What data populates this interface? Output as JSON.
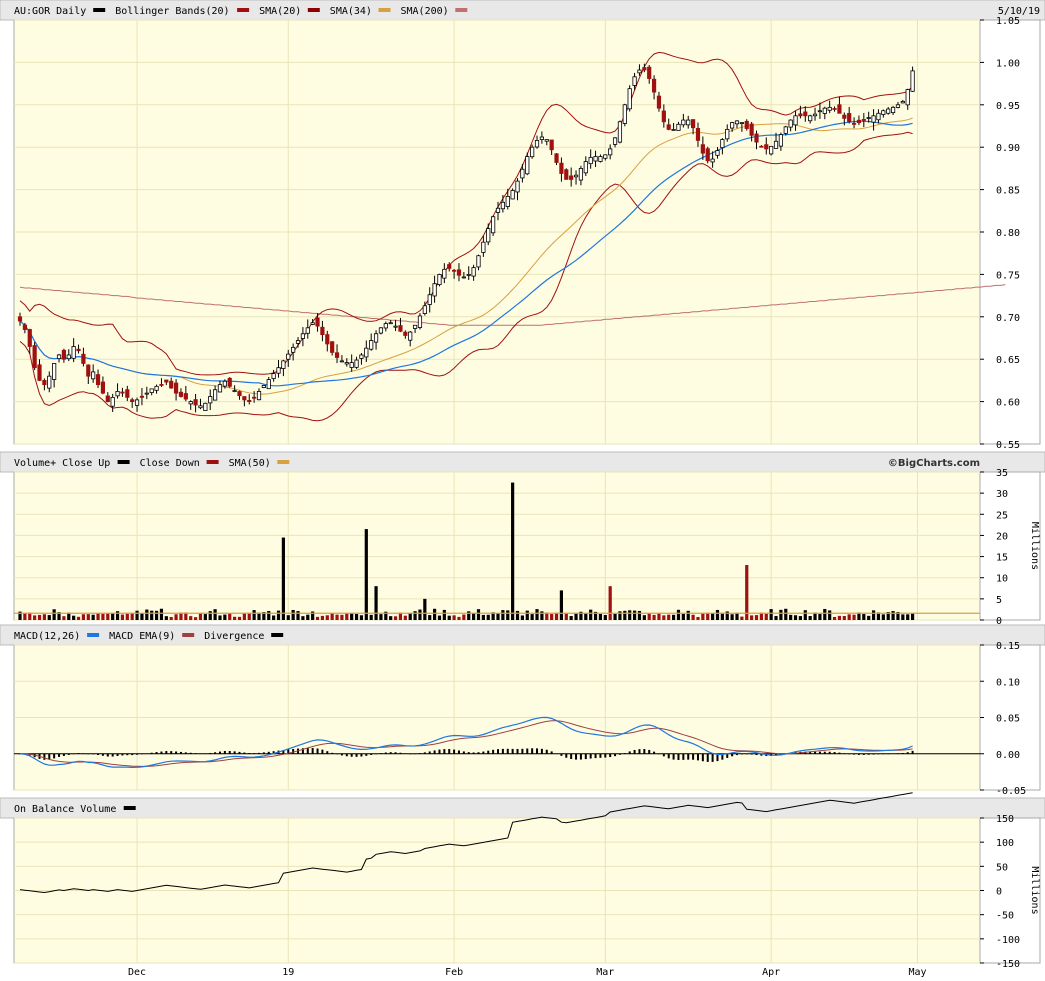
{
  "header": {
    "symbol_label": "AU:GOR Daily",
    "date": "5/10/19"
  },
  "colors": {
    "panel_bg": "#fffde1",
    "grid": "#e9e4b8",
    "header_bg": "#e8e8e8",
    "up": "#000000",
    "down": "#a01010",
    "bollinger": "#a01010",
    "sma20": "#8b0000",
    "sma34": "#d8a040",
    "sma200": "#1f77e0",
    "sma200_long": "#c07070",
    "vol_sma": "#d8a040",
    "macd": "#1f77e0",
    "macd_ema": "#a04040",
    "divergence": "#000000",
    "obv": "#000000"
  },
  "x_axis": {
    "labels": [
      {
        "text": "Dec",
        "index": 24
      },
      {
        "text": "19",
        "index": 55
      },
      {
        "text": "Feb",
        "index": 89
      },
      {
        "text": "Mar",
        "index": 120
      },
      {
        "text": "Apr",
        "index": 154
      },
      {
        "text": "May",
        "index": 184
      }
    ],
    "count": 197
  },
  "panels": [
    {
      "id": "price",
      "legend": [
        {
          "text": "AU:GOR Daily",
          "swatch": "#000000"
        },
        {
          "text": "Bollinger Bands(20)",
          "swatch": "#a01010"
        },
        {
          "text": "SMA(20)",
          "swatch": "#8b0000"
        },
        {
          "text": "SMA(34)",
          "swatch": "#d8a040"
        },
        {
          "text": "SMA(200)",
          "swatch": "#c07070"
        }
      ],
      "ticks": [
        "1.05",
        "1.00",
        "0.95",
        "0.90",
        "0.85",
        "0.80",
        "0.75",
        "0.70",
        "0.65",
        "0.60",
        "0.55"
      ],
      "ylim": [
        0.55,
        1.05
      ]
    },
    {
      "id": "volume",
      "legend": [
        {
          "text": "Volume+ Close Up",
          "swatch": "#000000"
        },
        {
          "text": "Close Down",
          "swatch": "#a01010"
        },
        {
          "text": "SMA(50)",
          "swatch": "#d8a040"
        }
      ],
      "brand": "©BigCharts.com",
      "ticks": [
        "35",
        "30",
        "25",
        "20",
        "15",
        "10",
        "5",
        "0"
      ],
      "unit": "Millions",
      "ylim": [
        0,
        35
      ]
    },
    {
      "id": "macd",
      "legend": [
        {
          "text": "MACD(12,26)",
          "swatch": "#1f77e0"
        },
        {
          "text": "MACD EMA(9)",
          "swatch": "#a04040"
        },
        {
          "text": "Divergence",
          "swatch": "#000000"
        }
      ],
      "ticks": [
        "0.15",
        "0.10",
        "0.05",
        "0.00",
        "-0.05"
      ],
      "ylim": [
        -0.05,
        0.15
      ]
    },
    {
      "id": "obv",
      "legend": [
        {
          "text": "On Balance Volume",
          "swatch": "#000000"
        }
      ],
      "ticks": [
        "150",
        "100",
        "50",
        "0",
        "-50",
        "-100",
        "-150"
      ],
      "unit": "Millions",
      "ylim": [
        -150,
        150
      ]
    }
  ],
  "chart_data": {
    "type": "candlestick",
    "closes": [
      0.695,
      0.685,
      0.665,
      0.64,
      0.625,
      0.62,
      0.63,
      0.645,
      0.655,
      0.65,
      0.655,
      0.665,
      0.66,
      0.645,
      0.63,
      0.635,
      0.62,
      0.61,
      0.6,
      0.605,
      0.612,
      0.61,
      0.605,
      0.6,
      0.602,
      0.605,
      0.61,
      0.615,
      0.618,
      0.62,
      0.623,
      0.616,
      0.61,
      0.606,
      0.603,
      0.6,
      0.596,
      0.595,
      0.598,
      0.606,
      0.614,
      0.62,
      0.624,
      0.618,
      0.613,
      0.607,
      0.602,
      0.6,
      0.605,
      0.612,
      0.619,
      0.626,
      0.633,
      0.64,
      0.648,
      0.656,
      0.664,
      0.672,
      0.68,
      0.687,
      0.693,
      0.689,
      0.679,
      0.668,
      0.658,
      0.652,
      0.648,
      0.646,
      0.646,
      0.649,
      0.655,
      0.663,
      0.672,
      0.68,
      0.687,
      0.692,
      0.693,
      0.689,
      0.683,
      0.678,
      0.682,
      0.69,
      0.701,
      0.713,
      0.726,
      0.739,
      0.75,
      0.756,
      0.757,
      0.754,
      0.749,
      0.747,
      0.75,
      0.758,
      0.772,
      0.788,
      0.804,
      0.818,
      0.828,
      0.835,
      0.842,
      0.849,
      0.86,
      0.874,
      0.889,
      0.9,
      0.908,
      0.912,
      0.909,
      0.897,
      0.882,
      0.869,
      0.862,
      0.862,
      0.867,
      0.875,
      0.883,
      0.888,
      0.889,
      0.889,
      0.891,
      0.898,
      0.911,
      0.93,
      0.95,
      0.969,
      0.983,
      0.991,
      0.991,
      0.981,
      0.965,
      0.946,
      0.93,
      0.921,
      0.921,
      0.927,
      0.932,
      0.932,
      0.923,
      0.908,
      0.893,
      0.884,
      0.886,
      0.896,
      0.909,
      0.921,
      0.929,
      0.931,
      0.929,
      0.922,
      0.914,
      0.906,
      0.9,
      0.898,
      0.901,
      0.907,
      0.915,
      0.924,
      0.932,
      0.937,
      0.937,
      0.937,
      0.937,
      0.939,
      0.943,
      0.946,
      0.947,
      0.945,
      0.94,
      0.934,
      0.93,
      0.928,
      0.929,
      0.932,
      0.935,
      0.937,
      0.94,
      0.943,
      0.945,
      0.947,
      0.95,
      0.954,
      0.968,
      0.99
    ],
    "sma200": [
      0.735,
      0.734,
      0.734,
      0.733,
      0.733,
      0.732,
      0.732,
      0.731,
      0.731,
      0.73,
      0.73,
      0.729,
      0.729,
      0.728,
      0.728,
      0.727,
      0.727,
      0.726,
      0.726,
      0.725,
      0.725,
      0.724,
      0.724,
      0.723,
      0.722,
      0.722,
      0.721,
      0.721,
      0.72,
      0.72,
      0.719,
      0.719,
      0.718,
      0.718,
      0.717,
      0.717,
      0.716,
      0.716,
      0.715,
      0.715,
      0.714,
      0.714,
      0.713,
      0.713,
      0.712,
      0.712,
      0.711,
      0.711,
      0.71,
      0.71,
      0.709,
      0.709,
      0.708,
      0.708,
      0.707,
      0.707,
      0.706,
      0.706,
      0.705,
      0.705,
      0.704,
      0.704,
      0.703,
      0.703,
      0.702,
      0.702,
      0.701,
      0.701,
      0.7,
      0.7,
      0.699,
      0.699,
      0.698,
      0.698,
      0.697,
      0.697,
      0.696,
      0.696,
      0.695,
      0.695,
      0.694,
      0.694,
      0.693,
      0.693,
      0.692,
      0.692,
      0.691,
      0.691,
      0.69,
      0.69,
      0.69,
      0.69,
      0.69,
      0.69,
      0.69,
      0.69,
      0.69,
      0.69,
      0.69,
      0.69,
      0.69,
      0.69,
      0.69,
      0.69,
      0.69,
      0.69,
      0.69,
      0.69,
      0.691,
      0.691,
      0.692,
      0.692,
      0.693,
      0.693,
      0.694,
      0.694,
      0.695,
      0.695,
      0.696,
      0.696,
      0.697,
      0.697,
      0.698,
      0.698,
      0.699,
      0.699,
      0.7,
      0.7,
      0.701,
      0.701,
      0.702,
      0.702,
      0.703,
      0.703,
      0.704,
      0.704,
      0.705,
      0.705,
      0.706,
      0.706,
      0.707,
      0.707,
      0.708,
      0.708,
      0.709,
      0.709,
      0.71,
      0.71,
      0.711,
      0.711,
      0.712,
      0.712,
      0.713,
      0.713,
      0.714,
      0.714,
      0.715,
      0.715,
      0.716,
      0.716,
      0.717,
      0.717,
      0.718,
      0.718,
      0.719,
      0.719,
      0.72,
      0.72,
      0.721,
      0.721,
      0.722,
      0.722,
      0.723,
      0.723,
      0.724,
      0.724,
      0.725,
      0.725,
      0.726,
      0.726,
      0.727,
      0.727,
      0.728,
      0.728,
      0.729,
      0.729,
      0.73,
      0.73,
      0.731,
      0.731,
      0.732,
      0.732,
      0.733,
      0.733,
      0.734,
      0.734,
      0.735,
      0.735,
      0.736,
      0.736,
      0.737,
      0.737,
      0.738
    ],
    "volume_spikes": [
      {
        "index": 54,
        "value": 19.5,
        "up": true
      },
      {
        "index": 71,
        "value": 21.5,
        "up": true
      },
      {
        "index": 73,
        "value": 8,
        "up": true
      },
      {
        "index": 83,
        "value": 5,
        "up": true
      },
      {
        "index": 101,
        "value": 32.5,
        "up": true
      },
      {
        "index": 111,
        "value": 7,
        "up": true
      },
      {
        "index": 121,
        "value": 8,
        "up": false
      },
      {
        "index": 149,
        "value": 13,
        "up": false
      }
    ],
    "volume_base_up": 1.8,
    "volume_base_down": 1.2,
    "volume_sma": 1.6
  }
}
